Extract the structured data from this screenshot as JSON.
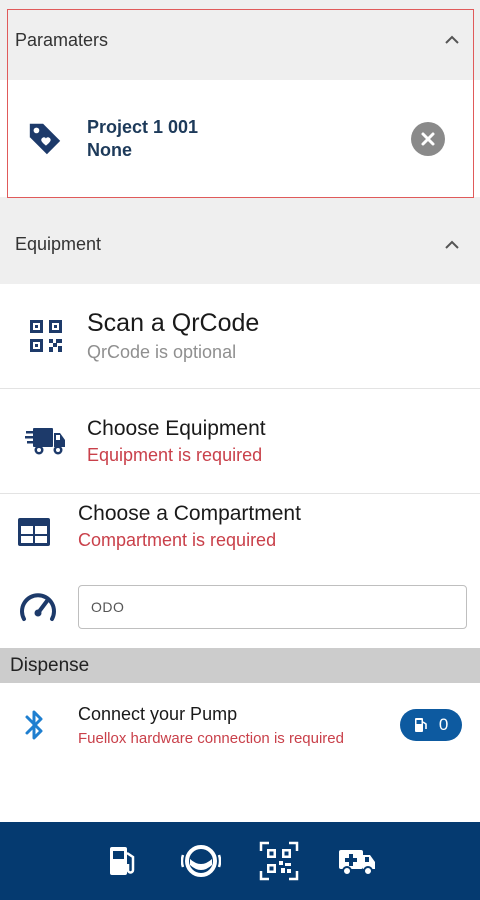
{
  "parameters": {
    "title": "Paramaters",
    "item": {
      "line1": "Project 1 001",
      "line2": "None"
    }
  },
  "equipment": {
    "title": "Equipment",
    "qr": {
      "title": "Scan a QrCode",
      "subtitle": "QrCode is optional"
    },
    "equipment": {
      "title": "Choose Equipment",
      "subtitle": "Equipment is required"
    },
    "compartment": {
      "title": "Choose a Compartment",
      "subtitle": "Compartment is required"
    },
    "odo": {
      "placeholder": "ODO"
    }
  },
  "dispense": {
    "title": "Dispense",
    "pump": {
      "title": "Connect your Pump",
      "subtitle": "Fuellox hardware connection is required"
    },
    "badge_count": "0"
  },
  "icons": {
    "tag": "tag-heart-icon",
    "clear": "close-circle-icon",
    "qr": "qrcode-icon",
    "truck": "truck-icon",
    "grid": "compartment-grid-icon",
    "gauge": "speedometer-icon",
    "bluetooth": "bluetooth-icon",
    "fuel": "fuel-pump-icon",
    "nav": [
      "fuel-pump-icon",
      "pump-ring-icon",
      "qr-scan-icon",
      "ambulance-truck-icon"
    ]
  },
  "colors": {
    "brand_navy": "#053a70",
    "icon_navy": "#1d3a6a",
    "required_red": "#c9404a",
    "badge_blue": "#0d5aa0",
    "header_grey": "#efefef",
    "dispense_grey": "#cccccc"
  }
}
